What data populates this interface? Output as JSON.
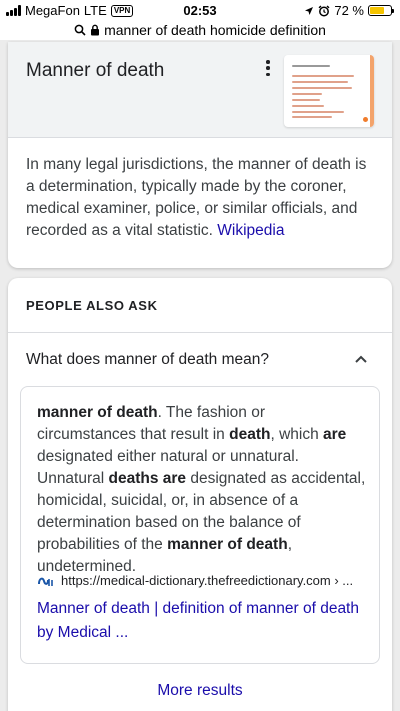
{
  "status_bar": {
    "carrier": "MegaFon",
    "network": "LTE",
    "vpn": "VPN",
    "time": "02:53",
    "battery": "72 %",
    "battery_level": 0.72
  },
  "url_bar": {
    "url": "manner of death homicide definition"
  },
  "knowledge_card": {
    "title": "Manner of death",
    "description": "In many legal jurisdictions, the manner of death is a determination, typically made by the coroner, medical examiner, police, or similar officials, and recorded as a vital statistic.",
    "source_link": "Wikipedia"
  },
  "people_also_ask": {
    "heading": "PEOPLE ALSO ASK",
    "question": "What does manner of death mean?",
    "answer_parts": [
      {
        "t": "manner of death",
        "b": true
      },
      {
        "t": ". The fashion or circumstances that result in ",
        "b": false
      },
      {
        "t": "death",
        "b": true
      },
      {
        "t": ", which ",
        "b": false
      },
      {
        "t": "are",
        "b": true
      },
      {
        "t": " designated either natural or unnatural. Unnatural ",
        "b": false
      },
      {
        "t": "deaths are",
        "b": true
      },
      {
        "t": " designated as accidental, homicidal, suicidal, or, in absence of a determination based on the balance of probabilities of the ",
        "b": false
      },
      {
        "t": "manner of death",
        "b": true
      },
      {
        "t": ", undetermined.",
        "b": false
      }
    ],
    "source_url": "https://medical-dictionary.thefreedictionary.com › ...",
    "result_title": "Manner of death | definition of manner of death by Medical ...",
    "more_results": "More results"
  }
}
